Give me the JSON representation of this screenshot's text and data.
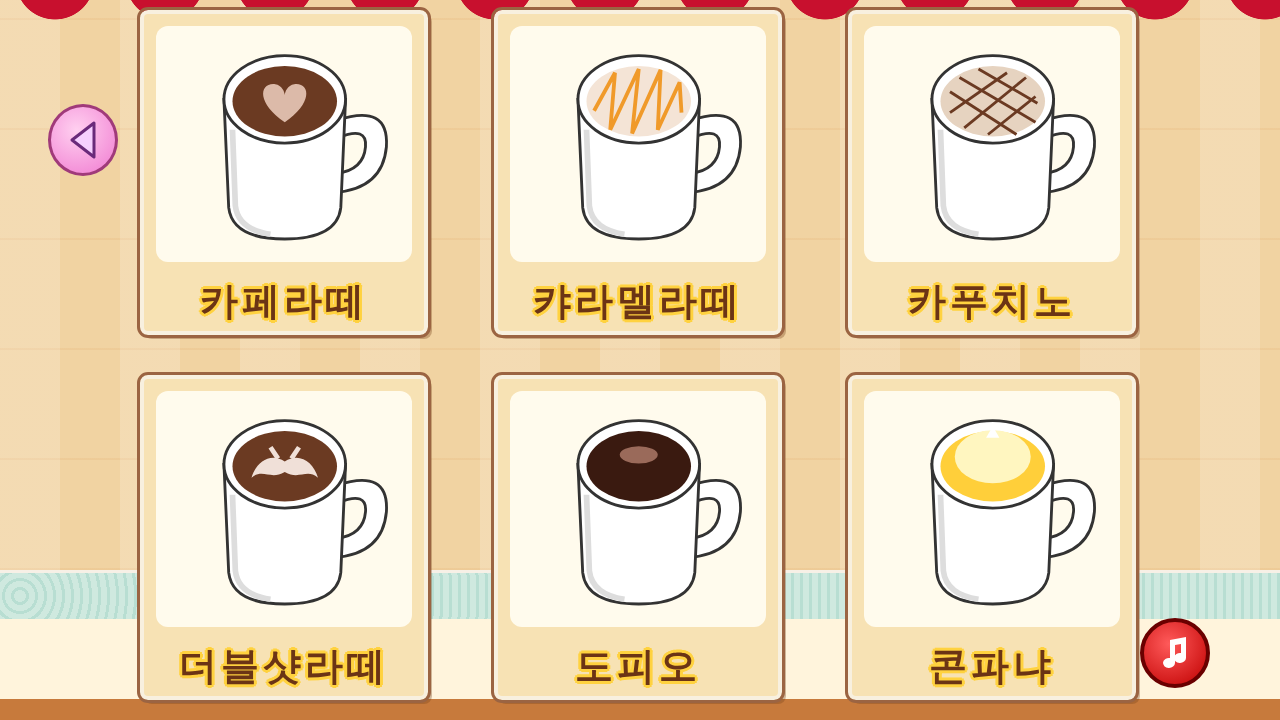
{
  "menu": [
    {
      "label": "카페라떼",
      "kind": "heart"
    },
    {
      "label": "캬라멜라떼",
      "kind": "caramel"
    },
    {
      "label": "카푸치노",
      "kind": "cappuccino"
    },
    {
      "label": "더블샷라떼",
      "kind": "mustache"
    },
    {
      "label": "도피오",
      "kind": "doppio"
    },
    {
      "label": "콘파냐",
      "kind": "conpanna"
    }
  ]
}
